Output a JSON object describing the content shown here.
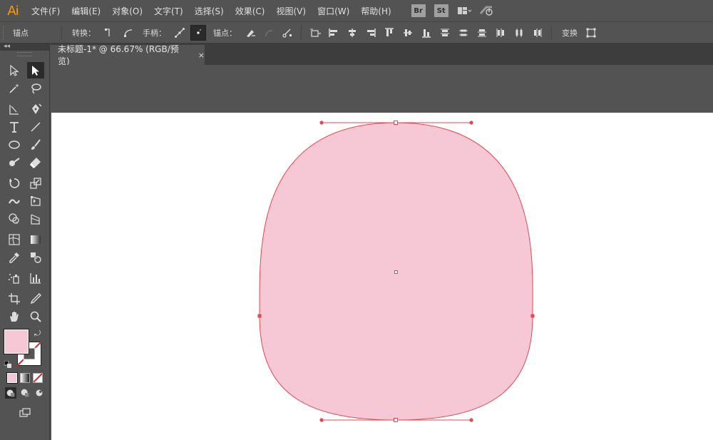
{
  "app": {
    "logo": "Ai"
  },
  "menu": [
    "文件(F)",
    "编辑(E)",
    "对象(O)",
    "文字(T)",
    "选择(S)",
    "效果(C)",
    "视图(V)",
    "窗口(W)",
    "帮助(H)"
  ],
  "menubar_right": {
    "bridge": "Br",
    "stock": "St"
  },
  "control": {
    "context_label": "锚点",
    "convert_label": "转换：",
    "handles_label": "手柄：",
    "anchors_label": "锚点：",
    "transform_label": "变换"
  },
  "document": {
    "tab_title": "未标题-1* @ 66.67% (RGB/预览)",
    "close_glyph": "×"
  },
  "colors": {
    "fill": "#f6c8d6",
    "stroke": "#e8474f",
    "path": "#e8474f",
    "accent_logo": "#ff9a00"
  },
  "icons": [
    "direct-selection-icon",
    "selection-icon",
    "magic-wand-icon",
    "lasso-icon",
    "pen-icon",
    "type-icon",
    "line-icon",
    "ellipse-icon",
    "paintbrush-icon",
    "blob-brush-icon",
    "eraser-icon",
    "rotate-icon",
    "scale-icon",
    "width-icon",
    "free-transform-icon",
    "shape-builder-icon",
    "perspective-icon",
    "mesh-icon",
    "gradient-icon",
    "eyedropper-icon",
    "blend-icon",
    "symbol-sprayer-icon",
    "graph-icon",
    "artboard-icon",
    "slice-icon",
    "hand-icon",
    "zoom-icon"
  ]
}
